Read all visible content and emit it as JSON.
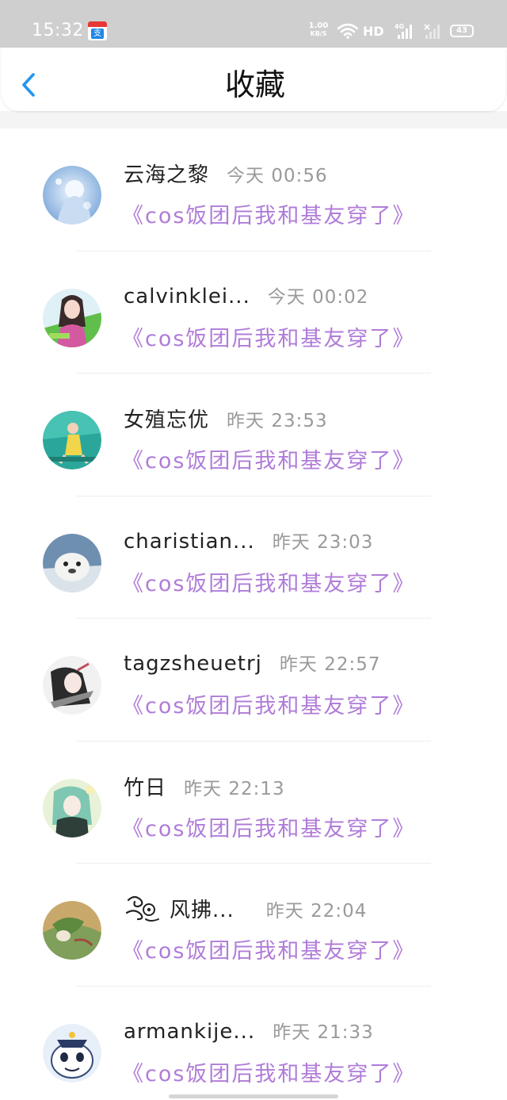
{
  "status_bar": {
    "time": "15:32",
    "app_icon": "alipay-icon",
    "app_badge_text": "支",
    "net_speed_value": "1.00",
    "net_speed_unit": "KB/S",
    "hd_label": "HD",
    "battery": "43",
    "icons": [
      "wifi-icon",
      "signal-4g-icon",
      "signal-icon",
      "battery-icon"
    ]
  },
  "header": {
    "title": "收藏",
    "back_icon": "chevron-left-icon"
  },
  "colors": {
    "accent": "#2196f3",
    "title_purple": "#b07cd8",
    "time_gray": "#9a9a9a",
    "status_bar_bg": "#cfcfcf"
  },
  "items": [
    {
      "name": "云海之黎",
      "time": "今天 00:56",
      "title": "《cos饭团后我和基友穿了》"
    },
    {
      "name": "calvinklei...",
      "time": "今天 00:02",
      "title": "《cos饭团后我和基友穿了》"
    },
    {
      "name": "女殖忘优",
      "time": "昨天 23:53",
      "title": "《cos饭团后我和基友穿了》"
    },
    {
      "name": "charistian...",
      "time": "昨天 23:03",
      "title": "《cos饭团后我和基友穿了》"
    },
    {
      "name": "tagzsheuetrj",
      "time": "昨天 22:57",
      "title": "《cos饭团后我和基友穿了》"
    },
    {
      "name": "竹日",
      "time": "昨天 22:13",
      "title": "《cos饭团后我和基友穿了》"
    },
    {
      "name": "风拂...",
      "time": "昨天 22:04",
      "title": "《cos饭团后我和基友穿了》"
    },
    {
      "name": "armankije...",
      "time": "昨天 21:33",
      "title": "《cos饭团后我和基友穿了》"
    }
  ]
}
